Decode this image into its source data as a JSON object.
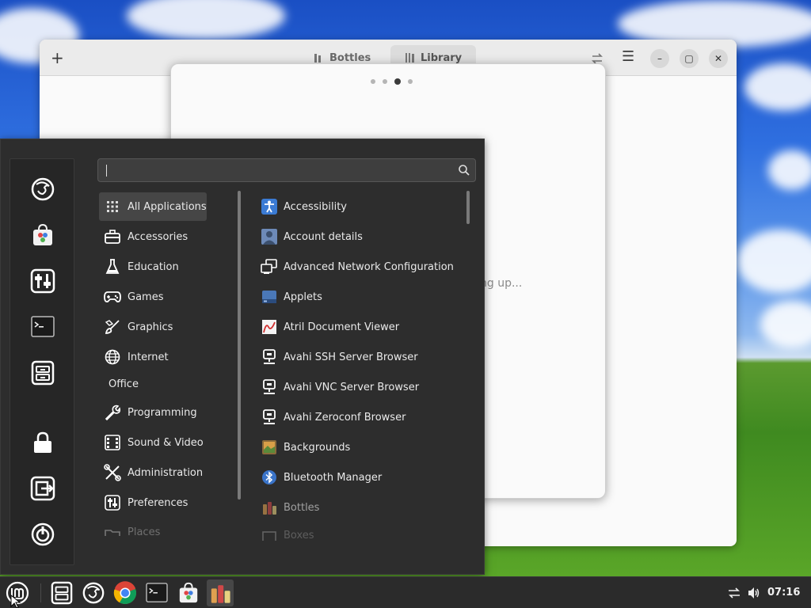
{
  "bottles_window": {
    "tabs": [
      {
        "label": "Bottles",
        "active": false
      },
      {
        "label": "Library",
        "active": true
      }
    ],
    "setup_dialog": {
      "pages_total": 4,
      "current_page": 3,
      "status_text": "ng up..."
    }
  },
  "menu": {
    "search": {
      "value": "",
      "placeholder": ""
    },
    "favorites": [
      {
        "name": "firefox-icon"
      },
      {
        "name": "software-manager-icon"
      },
      {
        "name": "settings-icon"
      },
      {
        "name": "terminal-icon"
      },
      {
        "name": "files-icon"
      },
      {
        "name": "lock-screen-icon"
      },
      {
        "name": "logout-icon"
      },
      {
        "name": "power-icon"
      }
    ],
    "categories": [
      {
        "label": "All Applications",
        "icon": "grid-icon",
        "active": true
      },
      {
        "label": "Accessories",
        "icon": "briefcase-icon"
      },
      {
        "label": "Education",
        "icon": "flask-icon"
      },
      {
        "label": "Games",
        "icon": "gamepad-icon"
      },
      {
        "label": "Graphics",
        "icon": "brush-icon"
      },
      {
        "label": "Internet",
        "icon": "globe-icon"
      },
      {
        "label": "Office",
        "icon": ""
      },
      {
        "label": "Programming",
        "icon": "wrench-icon"
      },
      {
        "label": "Sound & Video",
        "icon": "media-icon"
      },
      {
        "label": "Administration",
        "icon": "tools-icon"
      },
      {
        "label": "Preferences",
        "icon": "sliders-icon"
      },
      {
        "label": "Places",
        "icon": "folder-icon"
      }
    ],
    "applications": [
      {
        "label": "Accessibility",
        "icon": "accessibility-icon"
      },
      {
        "label": "Account details",
        "icon": "account-icon"
      },
      {
        "label": "Advanced Network Configuration",
        "icon": "network-icon"
      },
      {
        "label": "Applets",
        "icon": "applets-icon"
      },
      {
        "label": "Atril Document Viewer",
        "icon": "atril-icon"
      },
      {
        "label": "Avahi SSH Server Browser",
        "icon": "avahi-icon"
      },
      {
        "label": "Avahi VNC Server Browser",
        "icon": "avahi-icon"
      },
      {
        "label": "Avahi Zeroconf Browser",
        "icon": "avahi-icon"
      },
      {
        "label": "Backgrounds",
        "icon": "backgrounds-icon"
      },
      {
        "label": "Bluetooth Manager",
        "icon": "bluetooth-icon"
      },
      {
        "label": "Bottles",
        "icon": "bottles-icon"
      },
      {
        "label": "Boxes",
        "icon": "boxes-icon"
      }
    ]
  },
  "taskbar": {
    "items": [
      {
        "name": "menu-button"
      },
      {
        "name": "files-launcher"
      },
      {
        "name": "firefox-launcher"
      },
      {
        "name": "chrome-launcher"
      },
      {
        "name": "terminal-launcher"
      },
      {
        "name": "software-manager-launcher"
      },
      {
        "name": "bottles-window-button"
      }
    ],
    "clock": "07:16"
  }
}
